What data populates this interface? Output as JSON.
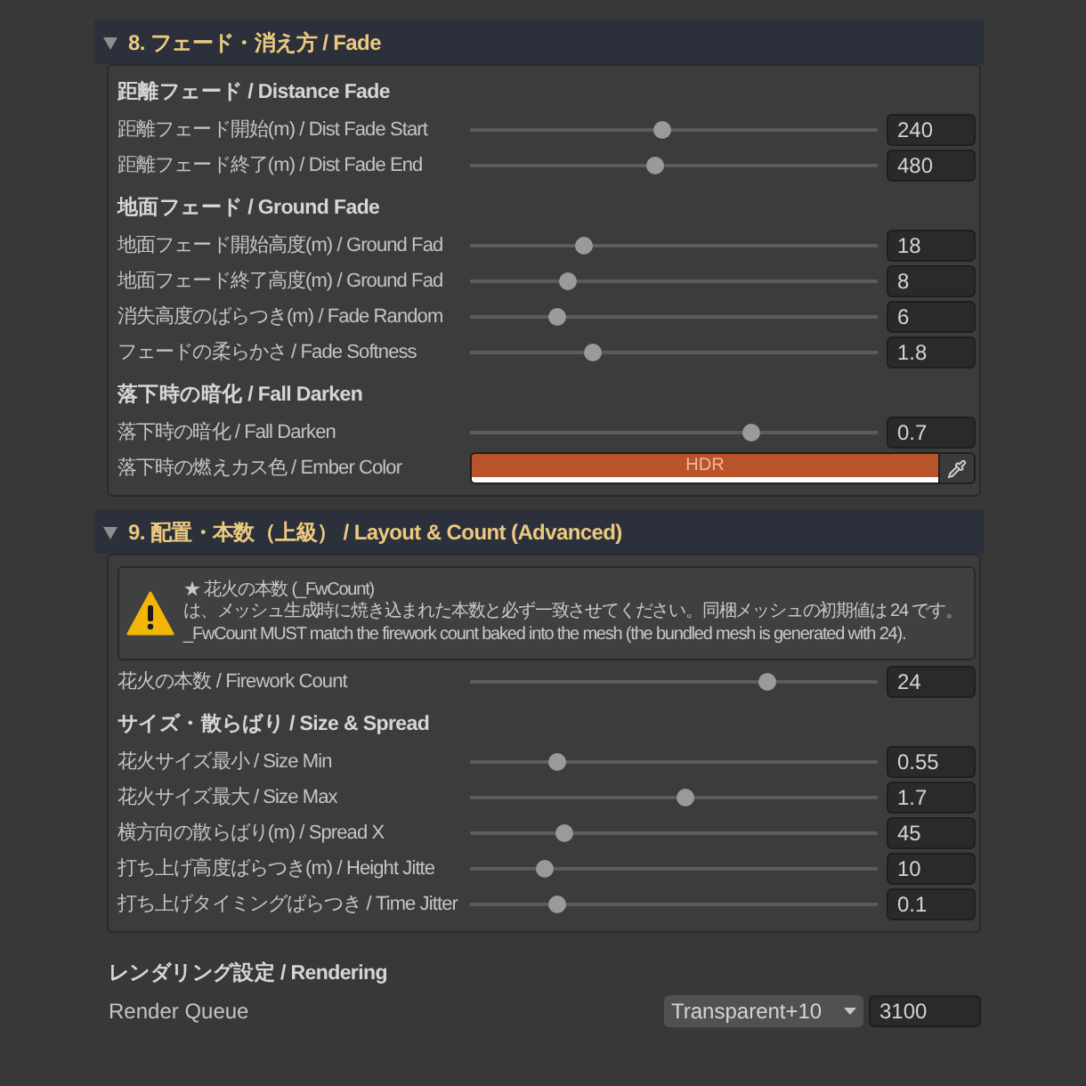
{
  "sections": [
    {
      "title": "8. フェード・消え方 / Fade",
      "expanded": true,
      "items": [
        {
          "kind": "heading",
          "label": "距離フェード / Distance Fade"
        },
        {
          "kind": "slider",
          "label": "距離フェード開始(m) / Dist Fade Start",
          "level": 0.47,
          "value": "240"
        },
        {
          "kind": "slider",
          "label": "距離フェード終了(m) / Dist Fade End",
          "level": 0.45,
          "value": "480"
        },
        {
          "kind": "heading",
          "label": "地面フェード / Ground Fade"
        },
        {
          "kind": "slider",
          "label": "地面フェード開始高度(m) / Ground Fad",
          "level": 0.27,
          "value": "18"
        },
        {
          "kind": "slider",
          "label": "地面フェード終了高度(m) / Ground Fad",
          "level": 0.23,
          "value": "8"
        },
        {
          "kind": "slider",
          "label": "消失高度のばらつき(m) / Fade Random",
          "level": 0.2,
          "value": "6"
        },
        {
          "kind": "slider",
          "label": "フェードの柔らかさ / Fade Softness",
          "level": 0.29,
          "value": "1.8"
        },
        {
          "kind": "heading",
          "label": "落下時の暗化 / Fall Darken"
        },
        {
          "kind": "slider",
          "label": "落下時の暗化 / Fall Darken",
          "level": 0.7,
          "value": "0.7"
        },
        {
          "kind": "color",
          "label": "落下時の燃えカス色 / Ember Color",
          "color": "#b9532a",
          "badge": "HDR"
        }
      ]
    },
    {
      "title": "9. 配置・本数（上級） / Layout & Count (Advanced)",
      "expanded": true,
      "items": [
        {
          "kind": "warning",
          "text": "★ 花火の本数 (_FwCount)\nは、メッシュ生成時に焼き込まれた本数と必ず一致させてください。同梱メッシュの初期値は 24 です。\n_FwCount MUST match the firework count baked into the mesh (the bundled mesh is generated with 24)."
        },
        {
          "kind": "slider",
          "label": "花火の本数 / Firework Count",
          "level": 0.74,
          "value": "24"
        },
        {
          "kind": "heading",
          "label": "サイズ・散らばり / Size & Spread"
        },
        {
          "kind": "slider",
          "label": "花火サイズ最小 / Size Min",
          "level": 0.2,
          "value": "0.55"
        },
        {
          "kind": "slider",
          "label": "花火サイズ最大 / Size Max",
          "level": 0.53,
          "value": "1.7"
        },
        {
          "kind": "slider",
          "label": "横方向の散らばり(m) / Spread X",
          "level": 0.22,
          "value": "45"
        },
        {
          "kind": "slider",
          "label": "打ち上げ高度ばらつき(m) / Height Jitte",
          "level": 0.17,
          "value": "10"
        },
        {
          "kind": "slider",
          "label": "打ち上げタイミングばらつき / Time Jitter",
          "level": 0.2,
          "value": "0.1"
        }
      ]
    }
  ],
  "rendering": {
    "title": "レンダリング設定 / Rendering",
    "label": "Render Queue",
    "dropdown": "Transparent+10",
    "value": "3100"
  }
}
